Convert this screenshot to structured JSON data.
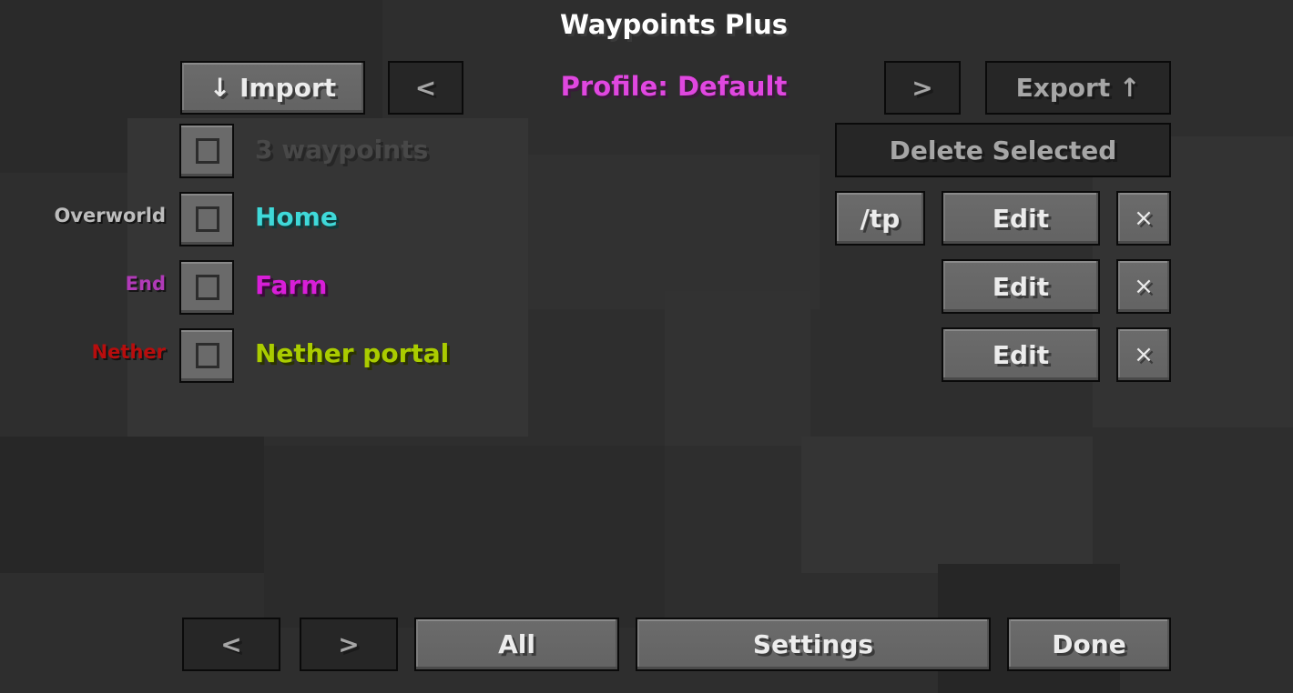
{
  "title": "Waypoints Plus",
  "header": {
    "import_label": "↓ Import",
    "prev_profile_label": "<",
    "profile_label": "Profile: Default",
    "next_profile_label": ">",
    "export_label": "Export ↑"
  },
  "selection": {
    "count_label": "3 waypoints",
    "delete_selected_label": "Delete Selected"
  },
  "waypoints": [
    {
      "dimension": "Overworld",
      "dimension_color": "#bdbdbd",
      "name": "Home",
      "name_color": "#3fd9d9",
      "tp_label": "/tp",
      "edit_label": "Edit",
      "delete_label": "×"
    },
    {
      "dimension": "End",
      "dimension_color": "#b13ab8",
      "name": "Farm",
      "name_color": "#d81ed8",
      "edit_label": "Edit",
      "delete_label": "×"
    },
    {
      "dimension": "Nether",
      "dimension_color": "#b80d0d",
      "name": "Nether portal",
      "name_color": "#aacc00",
      "edit_label": "Edit",
      "delete_label": "×"
    }
  ],
  "footer": {
    "prev_page_label": "<",
    "next_page_label": ">",
    "all_label": "All",
    "settings_label": "Settings",
    "done_label": "Done"
  },
  "colors": {
    "title": "#ffffff",
    "profile": "#e047e0",
    "count": "#484848"
  }
}
